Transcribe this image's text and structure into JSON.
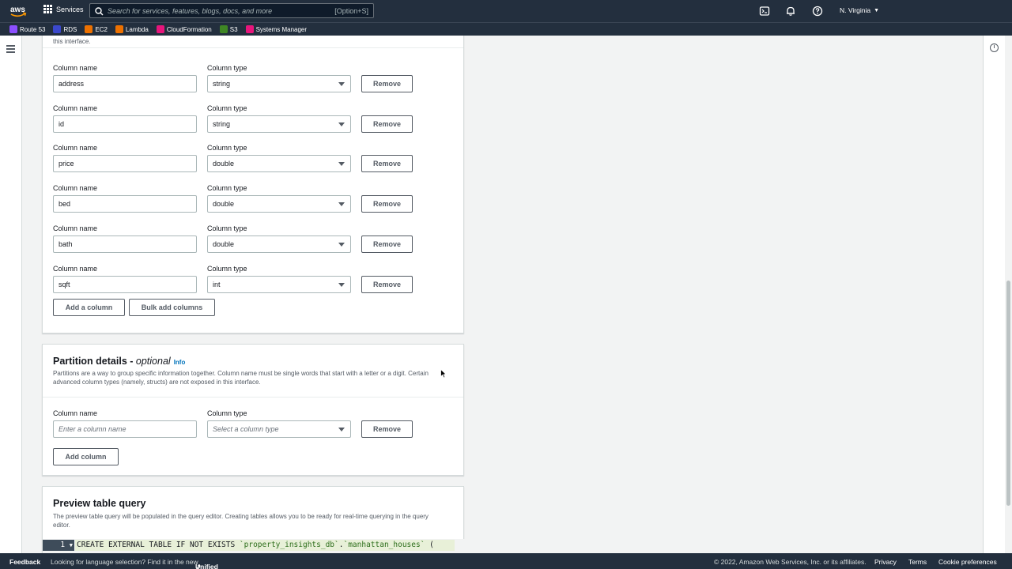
{
  "topnav": {
    "services_label": "Services",
    "search_placeholder": "Search for services, features, blogs, docs, and more",
    "search_shortcut": "[Option+S]",
    "region": "N. Virginia"
  },
  "favorites": [
    {
      "label": "Route 53",
      "color": "#8c4fff"
    },
    {
      "label": "RDS",
      "color": "#3b48cc"
    },
    {
      "label": "EC2",
      "color": "#ed7100"
    },
    {
      "label": "Lambda",
      "color": "#ed7100"
    },
    {
      "label": "CloudFormation",
      "color": "#e7157b"
    },
    {
      "label": "S3",
      "color": "#3f8624"
    },
    {
      "label": "Systems Manager",
      "color": "#e7157b"
    }
  ],
  "columns_card": {
    "top_note": "this interface.",
    "column_name_label": "Column name",
    "column_type_label": "Column type",
    "remove_label": "Remove",
    "rows": [
      {
        "name": "address",
        "type": "string"
      },
      {
        "name": "id",
        "type": "string"
      },
      {
        "name": "price",
        "type": "double"
      },
      {
        "name": "bed",
        "type": "double"
      },
      {
        "name": "bath",
        "type": "double"
      },
      {
        "name": "sqft",
        "type": "int"
      }
    ],
    "add_column_label": "Add a column",
    "bulk_add_label": "Bulk add columns"
  },
  "partition_card": {
    "title": "Partition details - ",
    "title_optional": "optional",
    "info_label": "Info",
    "description_line1": "Partitions are a way to group specific information together. Column name must be single words that start with a letter or a digit. Certain",
    "description_line2": "advanced column types (namely, structs) are not exposed in this interface.",
    "column_name_label": "Column name",
    "column_type_label": "Column type",
    "name_placeholder": "Enter a column name",
    "type_placeholder": "Select a column type",
    "remove_label": "Remove",
    "add_column_label": "Add column"
  },
  "preview_card": {
    "title": "Preview table query",
    "description_line1": "The preview table query will be populated in the query editor. Creating tables allows you to be ready for real-time querying in the query",
    "description_line2": "editor.",
    "line_number": "1",
    "code_prefix": "CREATE EXTERNAL TABLE IF NOT EXISTS ",
    "code_db": "`property_insights_db`",
    "code_dot": ".",
    "code_table": "`manhattan_houses`",
    "code_suffix": " ("
  },
  "footer": {
    "feedback": "Feedback",
    "language_note": "Looking for language selection? Find it in the new",
    "unified_settings": "Unified Settings",
    "copyright": "© 2022, Amazon Web Services, Inc. or its affiliates.",
    "privacy": "Privacy",
    "terms": "Terms",
    "cookies": "Cookie preferences"
  }
}
